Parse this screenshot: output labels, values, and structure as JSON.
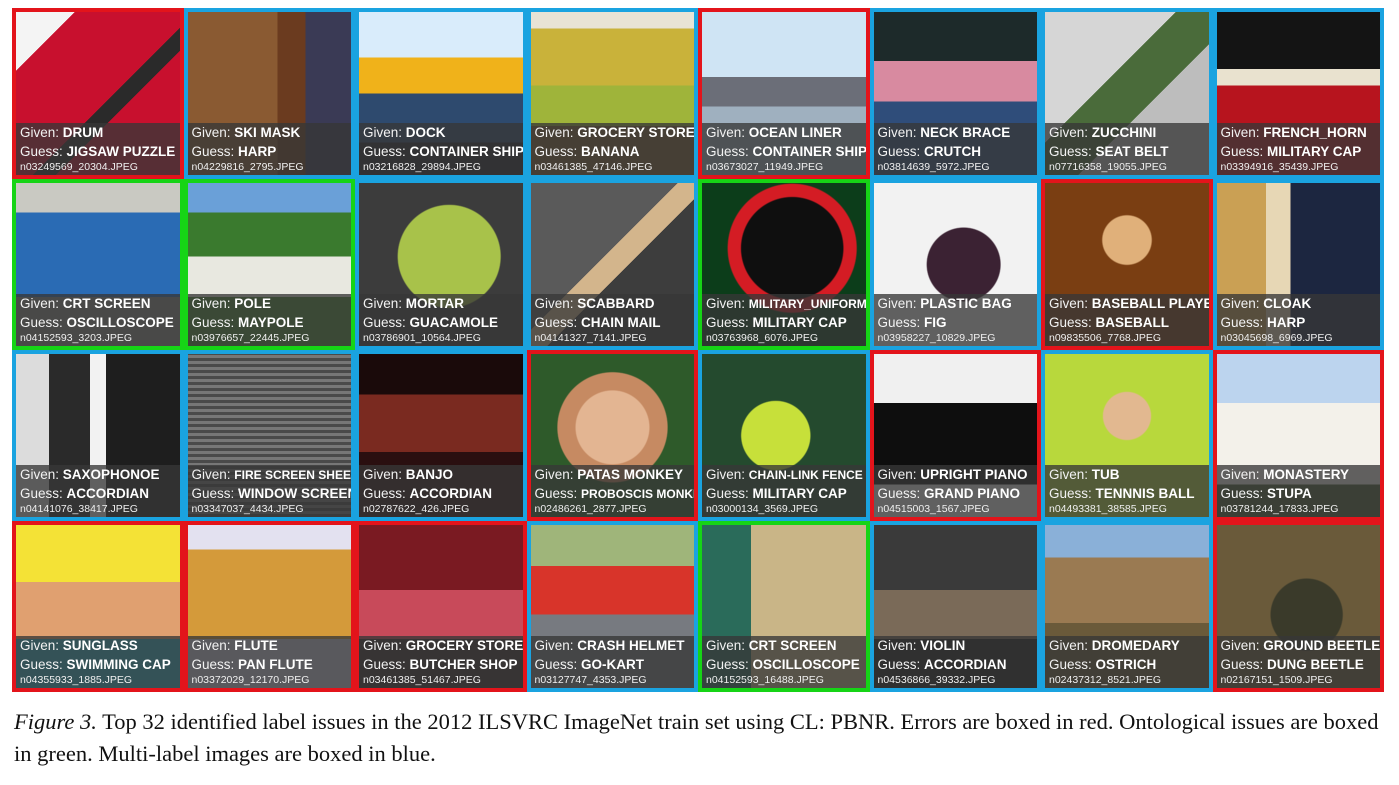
{
  "figure": {
    "caption_label": "Figure 3.",
    "caption_text": " Top 32 identified label issues in the 2012 ILSVRC ImageNet train set using CL: PBNR. Errors are boxed in red. Ontological issues are boxed in green. Multi-label images are boxed in blue."
  },
  "colors": {
    "error": "#e3141b",
    "ontological": "#16d416",
    "multi_label": "#1aa3e0"
  },
  "tiles": [
    {
      "given": "DRUM",
      "guess": "JIGSAW PUZZLE",
      "file": "n03249569_20304.JPEG",
      "category": "error",
      "scene": "jigsaw"
    },
    {
      "given": "SKI MASK",
      "guess": "HARP",
      "file": "n04229816_2795.JPEG",
      "category": "multi",
      "scene": "harp-room"
    },
    {
      "given": "DOCK",
      "guess": "CONTAINER SHIP",
      "file": "n03216828_29894.JPEG",
      "category": "multi",
      "scene": "dock"
    },
    {
      "given": "GROCERY STORE",
      "guess": "BANANA",
      "file": "n03461385_47146.JPEG",
      "category": "multi",
      "scene": "bananas"
    },
    {
      "given": "OCEAN LINER",
      "guess": "CONTAINER SHIP",
      "file": "n03673027_11949.JPEG",
      "category": "error",
      "scene": "ship"
    },
    {
      "given": "NECK BRACE",
      "guess": "CRUTCH",
      "file": "n03814639_5972.JPEG",
      "category": "multi",
      "scene": "crutch"
    },
    {
      "given": "ZUCCHINI",
      "guess": "SEAT BELT",
      "file": "n07716358_19055.JPEG",
      "category": "multi",
      "scene": "seatbelt"
    },
    {
      "given": "FRENCH_HORN",
      "guess": "MILITARY CAP",
      "file": "n03394916_35439.JPEG",
      "category": "multi",
      "scene": "guards"
    },
    {
      "given": "CRT SCREEN",
      "guess": "OSCILLOSCOPE",
      "file": "n04152593_3203.JPEG",
      "category": "ontological",
      "scene": "scope"
    },
    {
      "given": "POLE",
      "guess": "MAYPOLE",
      "file": "n03976657_22445.JPEG",
      "category": "ontological",
      "scene": "maypole"
    },
    {
      "given": "MORTAR",
      "guess": "GUACAMOLE",
      "file": "n03786901_10564.JPEG",
      "category": "multi",
      "scene": "guac"
    },
    {
      "given": "SCABBARD",
      "guess": "CHAIN MAIL",
      "file": "n04141327_7141.JPEG",
      "category": "multi",
      "scene": "chainmail"
    },
    {
      "given": "MILITARY_UNIFORM",
      "guess": "MILITARY CAP",
      "file": "n03763968_6076.JPEG",
      "category": "ontological",
      "scene": "busby"
    },
    {
      "given": "PLASTIC BAG",
      "guess": "FIG",
      "file": "n03958227_10829.JPEG",
      "category": "multi",
      "scene": "figs"
    },
    {
      "given": "BASEBALL PLAYER",
      "guess": "BASEBALL",
      "file": "n09835506_7768.JPEG",
      "category": "error",
      "scene": "baseball"
    },
    {
      "given": "CLOAK",
      "guess": "HARP",
      "file": "n03045698_6969.JPEG",
      "category": "multi",
      "scene": "cloak"
    },
    {
      "given": "SAXOPHONOE",
      "guess": "ACCORDIAN",
      "file": "n04141076_38417.JPEG",
      "category": "multi",
      "scene": "bw"
    },
    {
      "given": "FIRE SCREEN SHEET",
      "guess": "WINDOW SCREEN",
      "file": "n03347037_4434.JPEG",
      "category": "multi",
      "scene": "screen"
    },
    {
      "given": "BANJO",
      "guess": "ACCORDIAN",
      "file": "n02787622_426.JPEG",
      "category": "multi",
      "scene": "band"
    },
    {
      "given": "PATAS MONKEY",
      "guess": "PROBOSCIS MONKEY",
      "file": "n02486261_2877.JPEG",
      "category": "error",
      "scene": "monkey"
    },
    {
      "given": "CHAIN-LINK FENCE",
      "guess": "MILITARY CAP",
      "file": "n03000134_3569.JPEG",
      "category": "multi",
      "scene": "tennis"
    },
    {
      "given": "UPRIGHT PIANO",
      "guess": "GRAND PIANO",
      "file": "n04515003_1567.JPEG",
      "category": "error",
      "scene": "piano"
    },
    {
      "given": "TUB",
      "guess": "TENNNIS BALL",
      "file": "n04493381_38585.JPEG",
      "category": "multi",
      "scene": "tub"
    },
    {
      "given": "MONASTERY",
      "guess": "STUPA",
      "file": "n03781244_17833.JPEG",
      "category": "error",
      "scene": "stupa"
    },
    {
      "given": "SUNGLASS",
      "guess": "SWIMMING CAP",
      "file": "n04355933_1885.JPEG",
      "category": "error",
      "scene": "swimmer"
    },
    {
      "given": "FLUTE",
      "guess": "PAN FLUTE",
      "file": "n03372029_12170.JPEG",
      "category": "error",
      "scene": "panflute"
    },
    {
      "given": "GROCERY STORE",
      "guess": "BUTCHER SHOP",
      "file": "n03461385_51467.JPEG",
      "category": "error",
      "scene": "butcher"
    },
    {
      "given": "CRASH HELMET",
      "guess": "GO-KART",
      "file": "n03127747_4353.JPEG",
      "category": "multi",
      "scene": "kart"
    },
    {
      "given": "CRT SCREEN",
      "guess": "OSCILLOSCOPE",
      "file": "n04152593_16488.JPEG",
      "category": "ontological",
      "scene": "scope2"
    },
    {
      "given": "VIOLIN",
      "guess": "ACCORDIAN",
      "file": "n04536866_39332.JPEG",
      "category": "multi",
      "scene": "street"
    },
    {
      "given": "DROMEDARY",
      "guess": "OSTRICH",
      "file": "n02437312_8521.JPEG",
      "category": "multi",
      "scene": "camel"
    },
    {
      "given": "GROUND BEETLE",
      "guess": "DUNG BEETLE",
      "file": "n02167151_1509.JPEG",
      "category": "error",
      "scene": "beetle"
    }
  ],
  "labels": {
    "given_prefix": "Given: ",
    "guess_prefix": "Guess: "
  }
}
